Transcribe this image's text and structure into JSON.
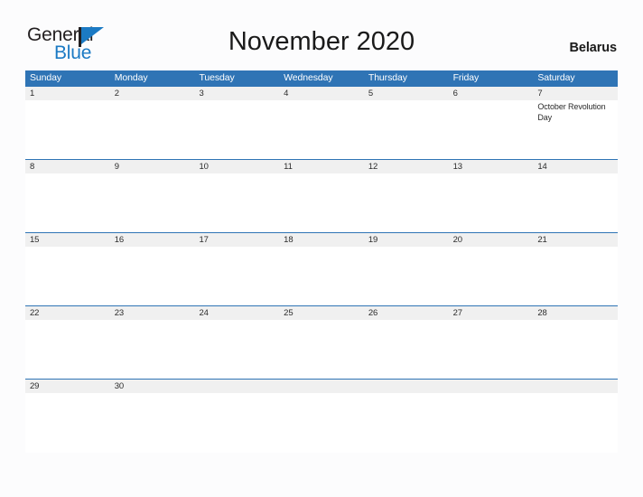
{
  "brand": {
    "word_one": "General",
    "word_two": "Blue",
    "flag_icon": "blue-flag-triangle-icon",
    "accent_color": "#1b7ac4"
  },
  "header": {
    "title": "November 2020",
    "country": "Belarus"
  },
  "theme": {
    "header_blue": "#2f74b5",
    "date_band_gray": "#f0f0f0",
    "page_background": "#fcfcfd",
    "text_color": "#2b2b2b"
  },
  "calendar": {
    "month": "November",
    "year": "2020",
    "weekday_headers": [
      "Sunday",
      "Monday",
      "Tuesday",
      "Wednesday",
      "Thursday",
      "Friday",
      "Saturday"
    ],
    "weeks": [
      {
        "days": [
          {
            "number": "1",
            "events": ""
          },
          {
            "number": "2",
            "events": ""
          },
          {
            "number": "3",
            "events": ""
          },
          {
            "number": "4",
            "events": ""
          },
          {
            "number": "5",
            "events": ""
          },
          {
            "number": "6",
            "events": ""
          },
          {
            "number": "7",
            "events": "October Revolution Day"
          }
        ]
      },
      {
        "days": [
          {
            "number": "8",
            "events": ""
          },
          {
            "number": "9",
            "events": ""
          },
          {
            "number": "10",
            "events": ""
          },
          {
            "number": "11",
            "events": ""
          },
          {
            "number": "12",
            "events": ""
          },
          {
            "number": "13",
            "events": ""
          },
          {
            "number": "14",
            "events": ""
          }
        ]
      },
      {
        "days": [
          {
            "number": "15",
            "events": ""
          },
          {
            "number": "16",
            "events": ""
          },
          {
            "number": "17",
            "events": ""
          },
          {
            "number": "18",
            "events": ""
          },
          {
            "number": "19",
            "events": ""
          },
          {
            "number": "20",
            "events": ""
          },
          {
            "number": "21",
            "events": ""
          }
        ]
      },
      {
        "days": [
          {
            "number": "22",
            "events": ""
          },
          {
            "number": "23",
            "events": ""
          },
          {
            "number": "24",
            "events": ""
          },
          {
            "number": "25",
            "events": ""
          },
          {
            "number": "26",
            "events": ""
          },
          {
            "number": "27",
            "events": ""
          },
          {
            "number": "28",
            "events": ""
          }
        ]
      },
      {
        "days": [
          {
            "number": "29",
            "events": ""
          },
          {
            "number": "30",
            "events": ""
          },
          {
            "number": "",
            "events": ""
          },
          {
            "number": "",
            "events": ""
          },
          {
            "number": "",
            "events": ""
          },
          {
            "number": "",
            "events": ""
          },
          {
            "number": "",
            "events": ""
          }
        ]
      }
    ]
  }
}
